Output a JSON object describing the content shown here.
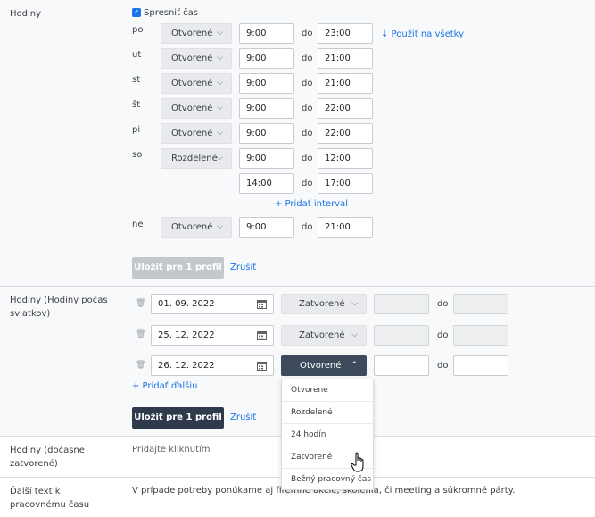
{
  "hours": {
    "label": "Hodiny",
    "specify_label": "Spresniť čas",
    "apply_all": "↓ Použiť na všetky",
    "days": [
      {
        "day": "po",
        "mode": "Otvorené",
        "from": "9:00",
        "to": "23:00"
      },
      {
        "day": "ut",
        "mode": "Otvorené",
        "from": "9:00",
        "to": "21:00"
      },
      {
        "day": "st",
        "mode": "Otvorené",
        "from": "9:00",
        "to": "21:00"
      },
      {
        "day": "št",
        "mode": "Otvorené",
        "from": "9:00",
        "to": "22:00"
      },
      {
        "day": "pi",
        "mode": "Otvorené",
        "from": "9:00",
        "to": "22:00"
      },
      {
        "day": "so",
        "mode": "Rozdelené",
        "from": "9:00",
        "to": "12:00",
        "from2": "14:00",
        "to2": "17:00"
      },
      {
        "day": "ne",
        "mode": "Otvorené",
        "from": "9:00",
        "to": "21:00"
      }
    ],
    "to_word": "do",
    "add_interval": "+ Pridať interval",
    "save_button": "Uložiť pre 1 profil",
    "cancel": "Zrušiť"
  },
  "special_hours": {
    "label": "Hodiny (Hodiny počas sviatkov)",
    "rows": [
      {
        "date": "01. 09. 2022",
        "mode": "Zatvorené"
      },
      {
        "date": "25. 12. 2022",
        "mode": "Zatvorené"
      },
      {
        "date": "26. 12. 2022",
        "mode": "Otvorené"
      }
    ],
    "to_word": "do",
    "add_more": "+ Pridať ďalšiu",
    "save_button": "Uložiť pre 1 profil",
    "cancel": "Zrušiť",
    "dropdown_options": [
      "Otvorené",
      "Rozdelené",
      "24 hodín",
      "Zatvorené",
      "Bežný pracovný čas"
    ]
  },
  "temp_closed": {
    "label": "Hodiny (dočasne zatvorené)",
    "value": "Pridajte kliknutím"
  },
  "extra_text": {
    "label": "Ďalší text k pracovnému času",
    "value": "V prípade potreby ponúkame aj firemné akcie, školenia, či meeting a súkromné párty."
  }
}
